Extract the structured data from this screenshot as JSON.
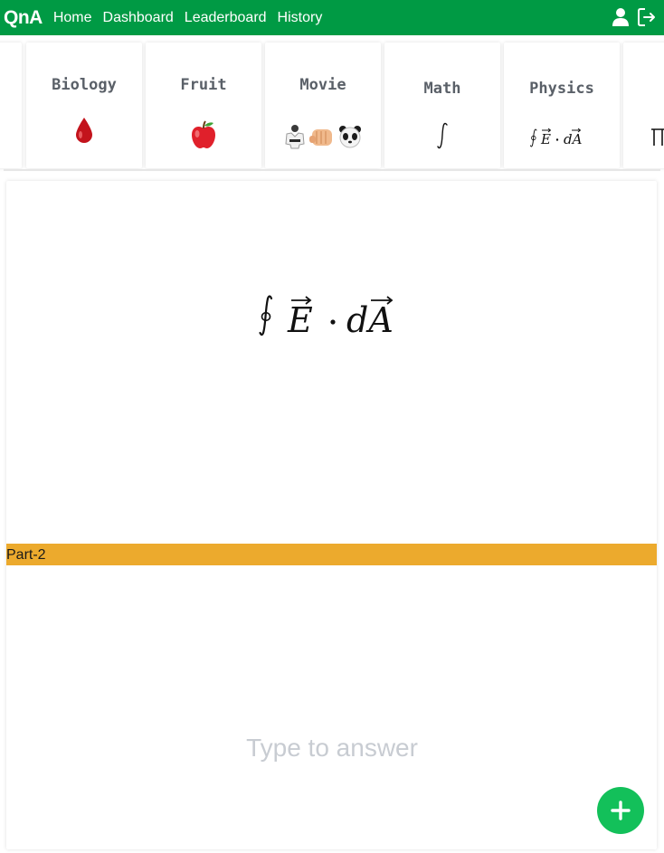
{
  "navbar": {
    "brand": "QnA",
    "links": [
      "Home",
      "Dashboard",
      "Leaderboard",
      "History"
    ],
    "icons": [
      "user-icon",
      "logout-icon"
    ],
    "color": "#009a44"
  },
  "categories": [
    {
      "label": "Biology",
      "symbol": "🩸",
      "symbol_name": "blood-drop-icon"
    },
    {
      "label": "Fruit",
      "symbol": "🍎",
      "symbol_name": "apple-icon"
    },
    {
      "label": "Movie",
      "symbol": "🥋👊🐼",
      "symbol_name": "kung-fu-panda-icon"
    },
    {
      "label": "Math",
      "symbol": "∫",
      "symbol_name": "integral-symbol"
    },
    {
      "label": "Physics",
      "symbol": "∮E·dA",
      "symbol_name": "gauss-law-formula"
    }
  ],
  "question": {
    "formula_text": "∮E·dA",
    "part_label": "Part-2",
    "part_color": "#ecaa2d",
    "answer_placeholder": "Type to answer"
  },
  "fab": {
    "icon": "plus-icon",
    "color": "#13c05a"
  }
}
